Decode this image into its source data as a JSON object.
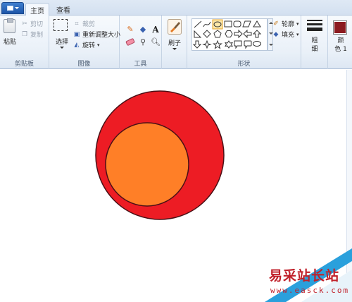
{
  "tabs": {
    "home": "主页",
    "view": "查看"
  },
  "clipboard": {
    "group_label": "剪贴板",
    "paste": "粘贴",
    "cut": "剪切",
    "copy": "复制"
  },
  "image": {
    "group_label": "图像",
    "select": "选择",
    "crop": "裁剪",
    "resize": "重新调整大小",
    "rotate": "旋转"
  },
  "tools": {
    "group_label": "工具",
    "text_glyph": "A"
  },
  "brushes": {
    "label": "刷子"
  },
  "shapes": {
    "group_label": "形状",
    "outline": "轮廓",
    "fill": "填充"
  },
  "size": {
    "label": "粗\n细"
  },
  "color1": {
    "label": "颜\n色 1",
    "color": "#8b1a1f"
  },
  "drawing": {
    "outer_circle_fill": "#ed1c24",
    "inner_circle_fill": "#ff7f27",
    "outline_color": "#4a1016"
  },
  "watermark": {
    "title": "易采站长站",
    "url": "www.easck.com"
  }
}
